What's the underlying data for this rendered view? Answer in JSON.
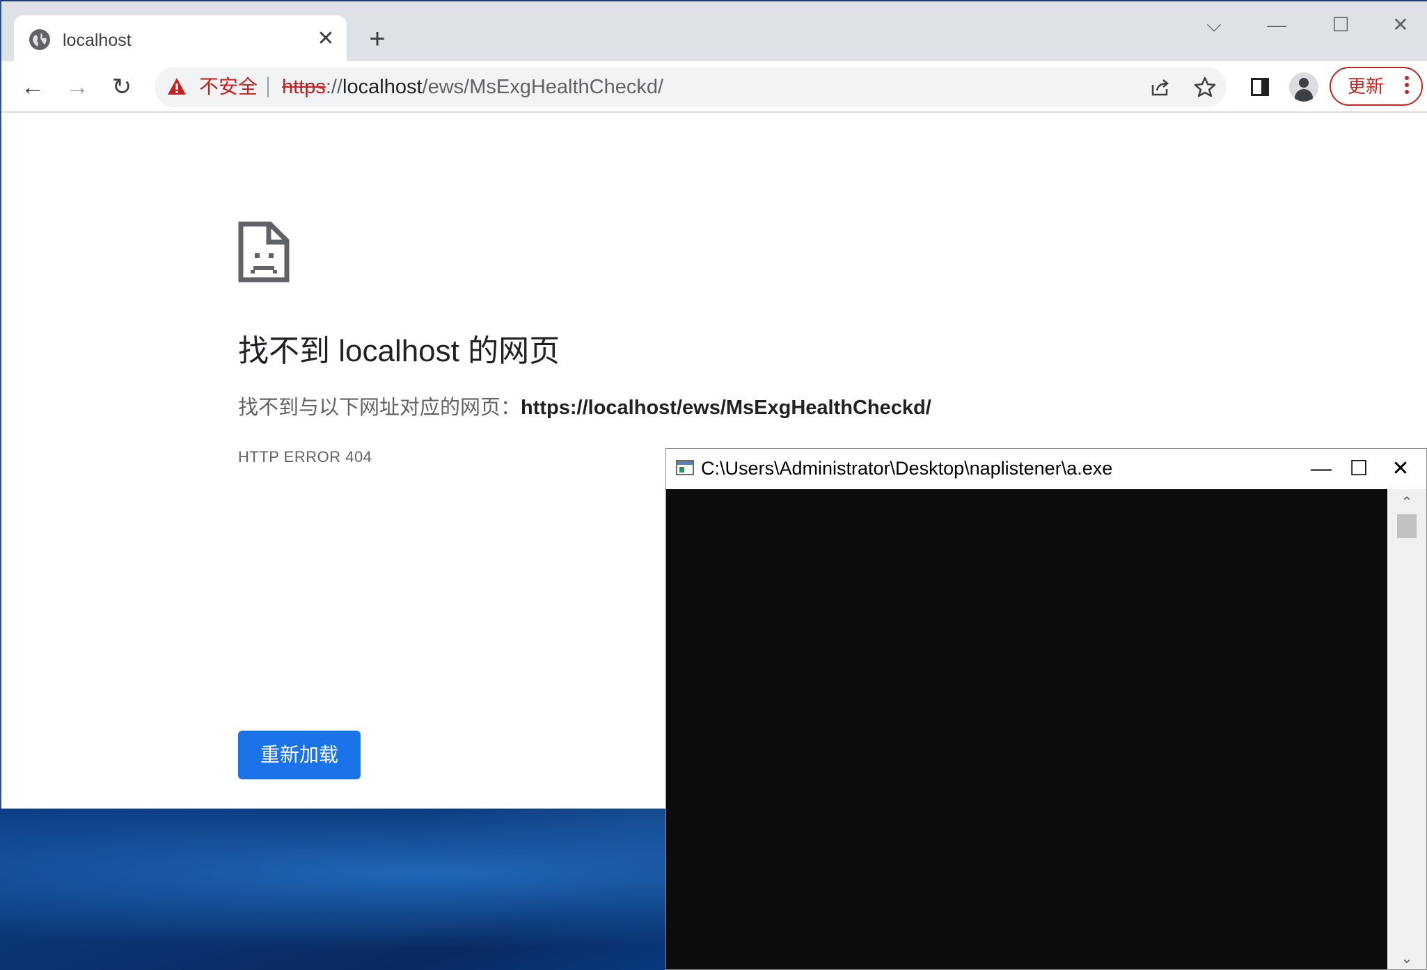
{
  "browser": {
    "tab": {
      "title": "localhost",
      "close_glyph": "✕",
      "icon": "globe-icon"
    },
    "new_tab_glyph": "+",
    "window_controls": {
      "dropdown": "⌵",
      "minimize": "—",
      "maximize": "☐",
      "close": "✕"
    },
    "nav": {
      "back": "←",
      "forward": "→",
      "reload": "↻"
    },
    "omnibox": {
      "security_label": "不安全",
      "url_scheme": "https",
      "url_sep": "://",
      "url_host": "localhost",
      "url_path": "/ews/MsExgHealthCheckd/"
    },
    "update_button": {
      "label": "更新"
    },
    "colors": {
      "insecure": "#c5221f",
      "reload_button": "#1a73e8"
    }
  },
  "error_page": {
    "heading": "找不到 localhost 的网页",
    "description_prefix": "找不到与以下网址对应的网页：",
    "description_url": "https://localhost/ews/MsExgHealthCheckd/",
    "error_code": "HTTP ERROR 404",
    "reload_label": "重新加载"
  },
  "console_window": {
    "title": "C:\\Users\\Administrator\\Desktop\\naplistener\\a.exe",
    "controls": {
      "minimize": "—",
      "maximize": "☐",
      "close": "✕"
    },
    "scroll": {
      "up": "⌃",
      "down": "⌄"
    }
  }
}
